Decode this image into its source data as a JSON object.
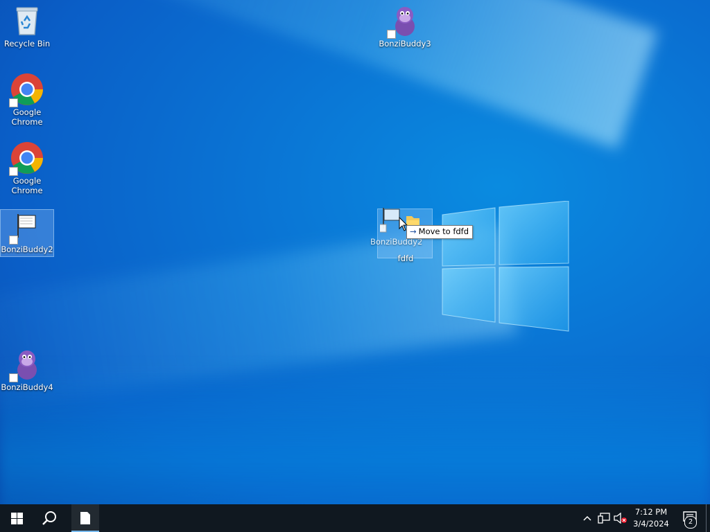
{
  "desktop": {
    "icons": [
      {
        "label": "Recycle Bin"
      },
      {
        "label": "Google Chrome"
      },
      {
        "label": "Google Chrome"
      },
      {
        "label": "BonziBuddy2"
      },
      {
        "label": "BonziBuddy4"
      },
      {
        "label": "BonziBuddy3"
      },
      {
        "label": "fdfd"
      }
    ],
    "drag": {
      "ghost_label": "BonziBuddy2",
      "tooltip": "Move to fdfd"
    }
  },
  "taskbar": {
    "time": "7:12 PM",
    "date": "3/4/2024",
    "notification_count": "2"
  },
  "colors": {
    "taskbar_bg": "#101820",
    "accent": "#76b9ed"
  }
}
